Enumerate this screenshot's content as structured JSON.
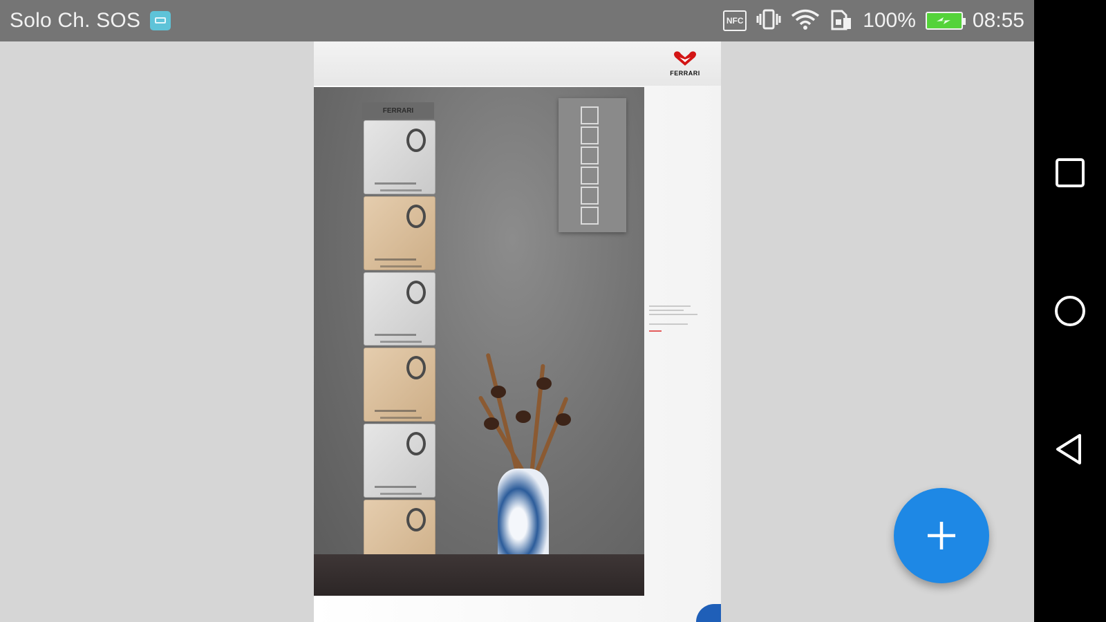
{
  "status_bar": {
    "carrier": "Solo Ch. SOS",
    "notification_icon": "android-notification-icon",
    "nfc_label": "NFC",
    "battery_percent": "100%",
    "battery_level": 1.0,
    "time": "08:55"
  },
  "document": {
    "brand_logo": "ferrari-brand-logo",
    "brand": "FERRARI",
    "photo_brand": "FERRARI",
    "colors": {
      "accent_corner": "#1f5fb8",
      "price_text": "#dd1111"
    }
  },
  "fab": {
    "icon": "plus-icon",
    "color": "#1e88e5"
  },
  "nav_bar": {
    "buttons": [
      "recent-apps-icon",
      "home-icon",
      "back-icon"
    ]
  }
}
